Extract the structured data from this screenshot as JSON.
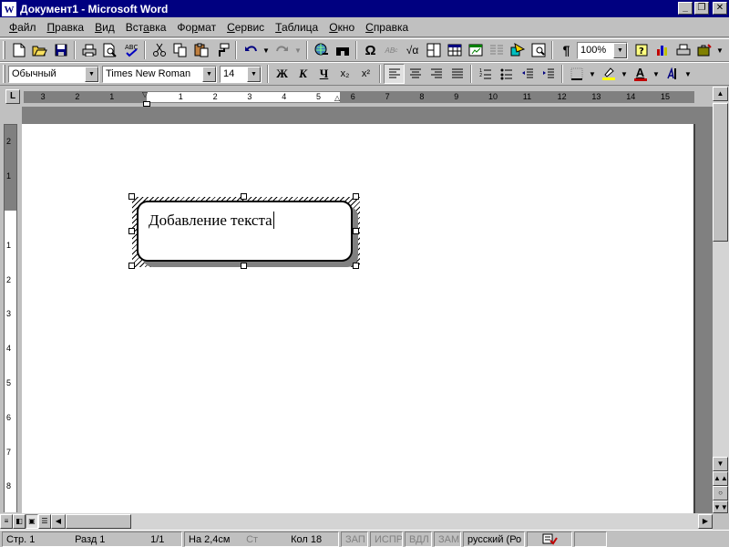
{
  "window": {
    "icon": "W",
    "title": "Документ1 - Microsoft Word",
    "min_glyph": "_",
    "max_glyph": "❐",
    "close_glyph": "✕"
  },
  "menu": [
    {
      "pre": "",
      "u": "Ф",
      "post": "айл"
    },
    {
      "pre": "",
      "u": "П",
      "post": "равка"
    },
    {
      "pre": "",
      "u": "В",
      "post": "ид"
    },
    {
      "pre": "Вст",
      "u": "а",
      "post": "вка"
    },
    {
      "pre": "Фо",
      "u": "р",
      "post": "мат"
    },
    {
      "pre": "",
      "u": "С",
      "post": "ервис"
    },
    {
      "pre": "",
      "u": "Т",
      "post": "аблица"
    },
    {
      "pre": "",
      "u": "О",
      "post": "кно"
    },
    {
      "pre": "",
      "u": "С",
      "post": "правка"
    }
  ],
  "standard_toolbar": {
    "zoom": "100%",
    "pilcrow": "¶",
    "omega": "Ω",
    "sqrt": "√α"
  },
  "format_toolbar": {
    "style": "Обычный",
    "font": "Times New Roman",
    "size": "14",
    "bold": "Ж",
    "italic": "К",
    "underline": "Ч",
    "subscript": "x₂",
    "superscript": "x²",
    "font_color_letter": "A"
  },
  "ruler": {
    "h_left": [
      "3",
      "2",
      "1"
    ],
    "h_right": [
      "1",
      "2",
      "3",
      "4",
      "5",
      "6",
      "7",
      "8",
      "9",
      "10",
      "11",
      "12",
      "13",
      "14",
      "15"
    ],
    "v_top": [
      "2",
      "1"
    ],
    "v_bottom": [
      "1",
      "2",
      "3",
      "4",
      "5",
      "6",
      "7",
      "8"
    ],
    "tab_stop": "L"
  },
  "document": {
    "callout_text": "Добавление текста"
  },
  "status": {
    "page": "Стр. 1",
    "section": "Разд 1",
    "pages": "1/1",
    "at": "На 2,4см",
    "line": "Ст",
    "col": "Кол 18",
    "rec": "ЗАП",
    "trk": "ИСПР",
    "ext": "ВДЛ",
    "ovr": "ЗАМ",
    "lang": "русский (Ро"
  }
}
